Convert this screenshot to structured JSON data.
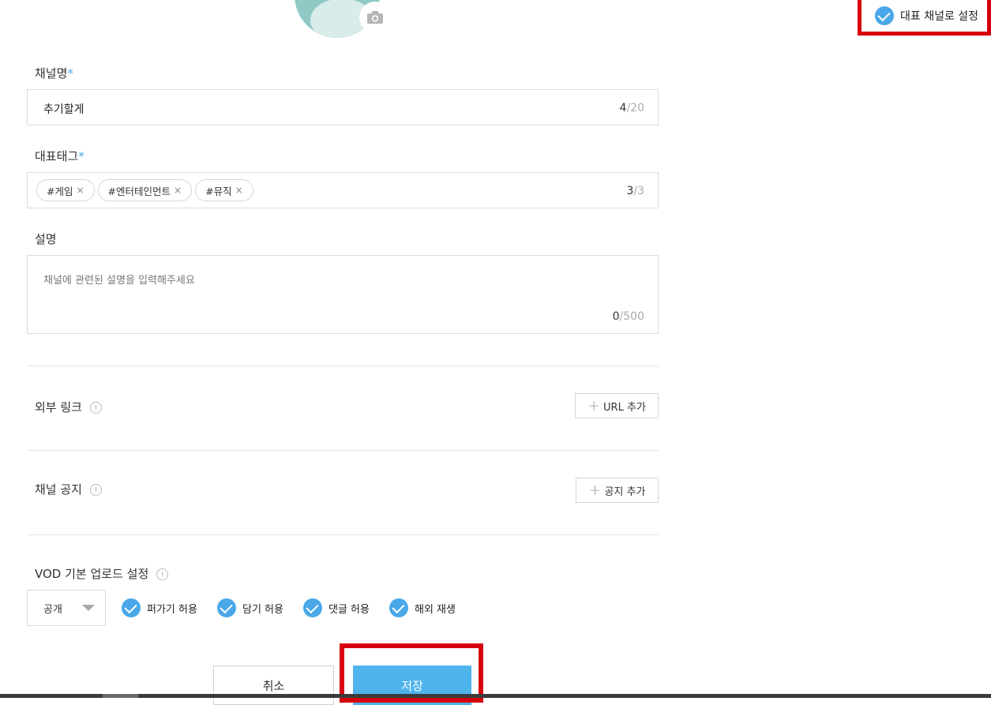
{
  "header": {
    "rep_channel_label": "대표 채널로 설정"
  },
  "channel_name": {
    "label": "채널명",
    "required_mark": "*",
    "value": "추기할게",
    "count": "4",
    "max": "/20"
  },
  "tags": {
    "label": "대표태그",
    "required_mark": "*",
    "items": [
      "#게임",
      "#엔터테인먼트",
      "#뮤직"
    ],
    "remove_glyph": "×",
    "count": "3",
    "max": "/3"
  },
  "description": {
    "label": "설명",
    "placeholder": "채널에 관련된 설명을 입력해주세요",
    "count": "0",
    "max": "/500"
  },
  "external_link": {
    "label": "외부 링크",
    "info_glyph": "!",
    "add_label": "URL 추가",
    "plus_glyph": "+"
  },
  "notice": {
    "label": "채널 공지",
    "info_glyph": "!",
    "add_label": "공지 추가",
    "plus_glyph": "+"
  },
  "vod": {
    "label": "VOD 기본 업로드 설정",
    "info_glyph": "!",
    "visibility_selected": "공개",
    "options": [
      "퍼가기 허용",
      "담기 허용",
      "댓글 허용",
      "해외 재생"
    ]
  },
  "actions": {
    "cancel_label": "취소",
    "save_label": "저장"
  },
  "colors": {
    "accent": "#4aa8e8",
    "save_button": "#4fb3ec",
    "highlight_frame": "#d7000f",
    "avatar": "#8ec9c6"
  }
}
